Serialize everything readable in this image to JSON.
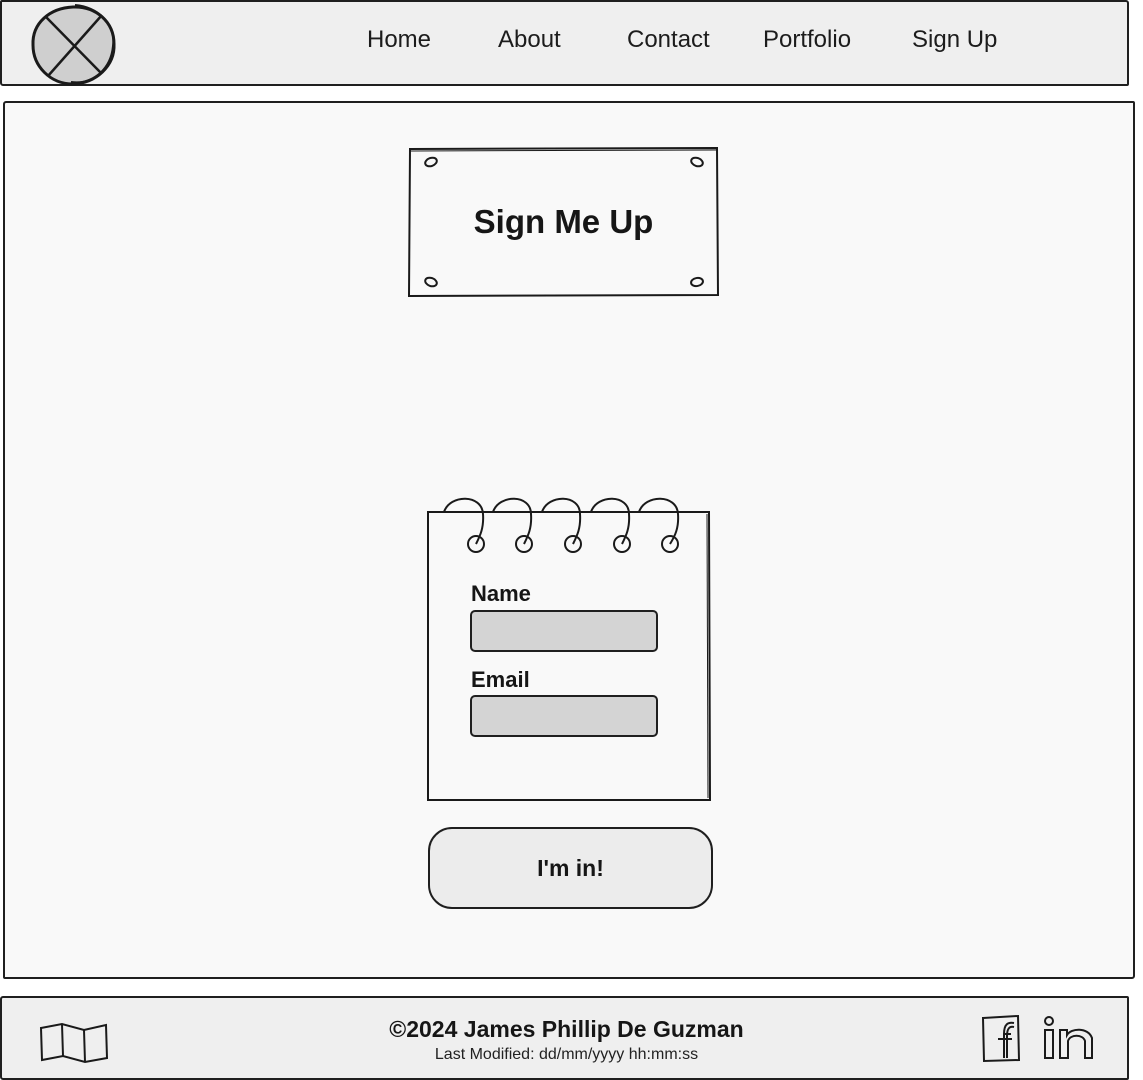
{
  "header": {
    "logo_icon": "placeholder-x-circle-icon",
    "nav": [
      {
        "label": "Home"
      },
      {
        "label": "About"
      },
      {
        "label": "Contact"
      },
      {
        "label": "Portfolio"
      },
      {
        "label": "Sign Up"
      }
    ]
  },
  "main": {
    "title": "Sign Me Up",
    "form": {
      "name_label": "Name",
      "name_value": "",
      "email_label": "Email",
      "email_value": "",
      "submit_label": "I'm in!"
    }
  },
  "footer": {
    "copyright": "©2024 James Phillip De Guzman",
    "last_modified": "Last Modified: dd/mm/yyyy hh:mm:ss",
    "icons": [
      "map-icon",
      "facebook-icon",
      "linkedin-icon"
    ]
  },
  "colors": {
    "ink": "#1f1f1f",
    "panel": "#efefef",
    "main_bg": "#f9f9f9",
    "input_fill": "#d4d4d4",
    "logo_fill": "#cfcfcf"
  }
}
